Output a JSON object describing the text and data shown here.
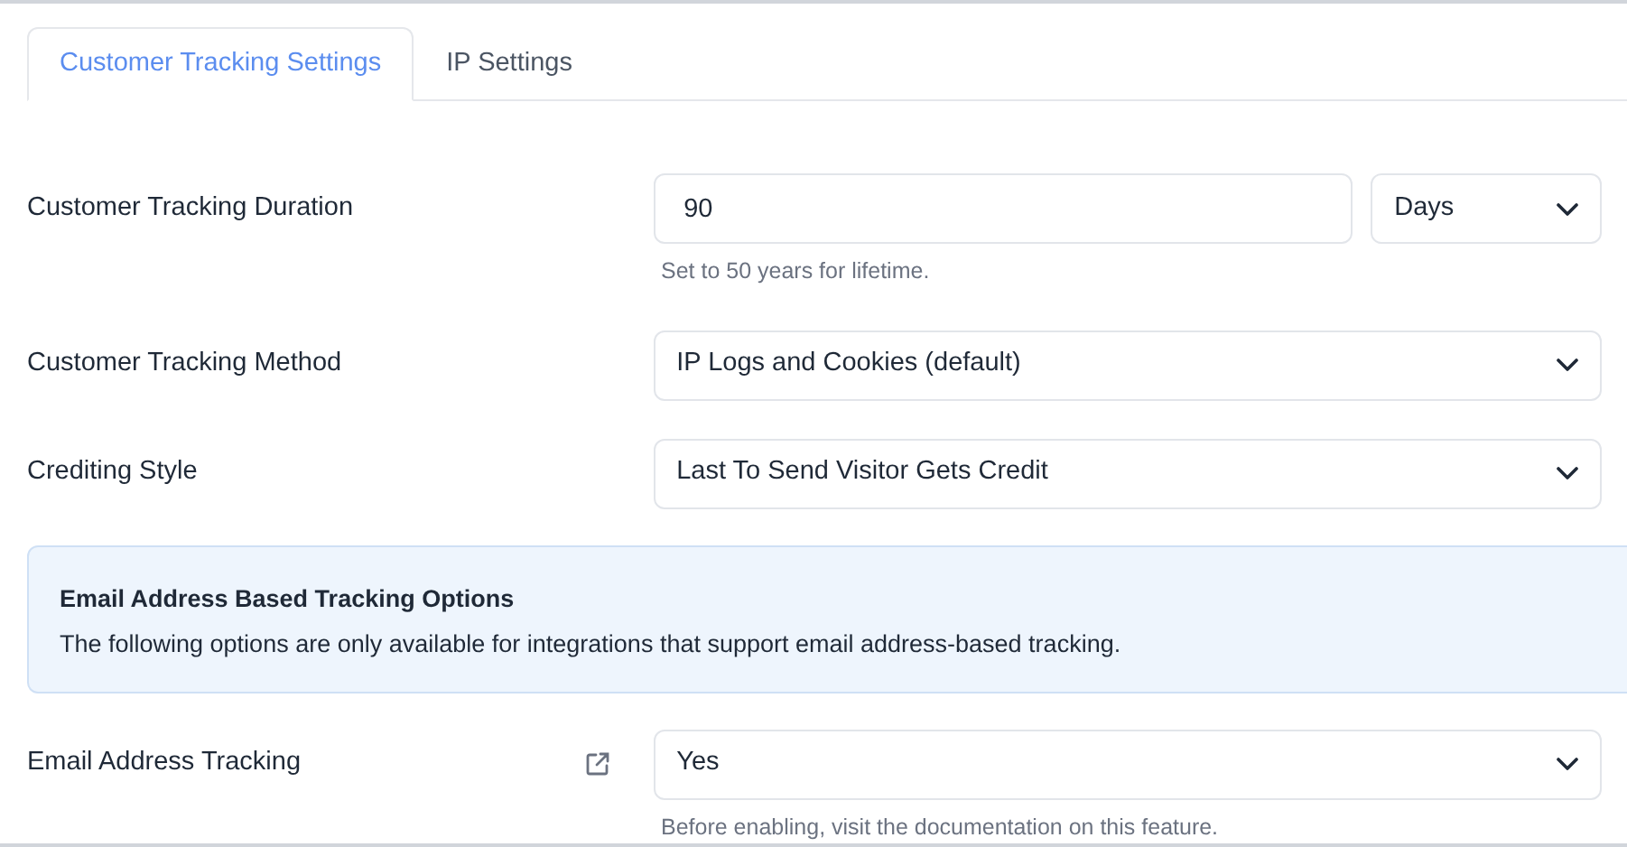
{
  "tabs": [
    {
      "label": "Customer Tracking Settings",
      "selected": true
    },
    {
      "label": "IP Settings",
      "selected": false
    }
  ],
  "rows": [
    {
      "kind": "duration",
      "label": "Customer Tracking Duration",
      "value": "90",
      "unit": "Days",
      "hint": "Set to 50 years for lifetime."
    },
    {
      "kind": "select",
      "label": "Customer Tracking Method",
      "value": "IP Logs and Cookies (default)"
    },
    {
      "kind": "select",
      "label": "Crediting Style",
      "value": "Last To Send Visitor Gets Credit"
    },
    {
      "kind": "notice",
      "title": "Email Address Based Tracking Options",
      "text": "The following options are only available for integrations that support email address-based tracking."
    },
    {
      "kind": "select",
      "label": "Email Address Tracking",
      "value": "Yes",
      "link": true,
      "hint": "Before enabling, visit the documentation on this feature."
    }
  ]
}
